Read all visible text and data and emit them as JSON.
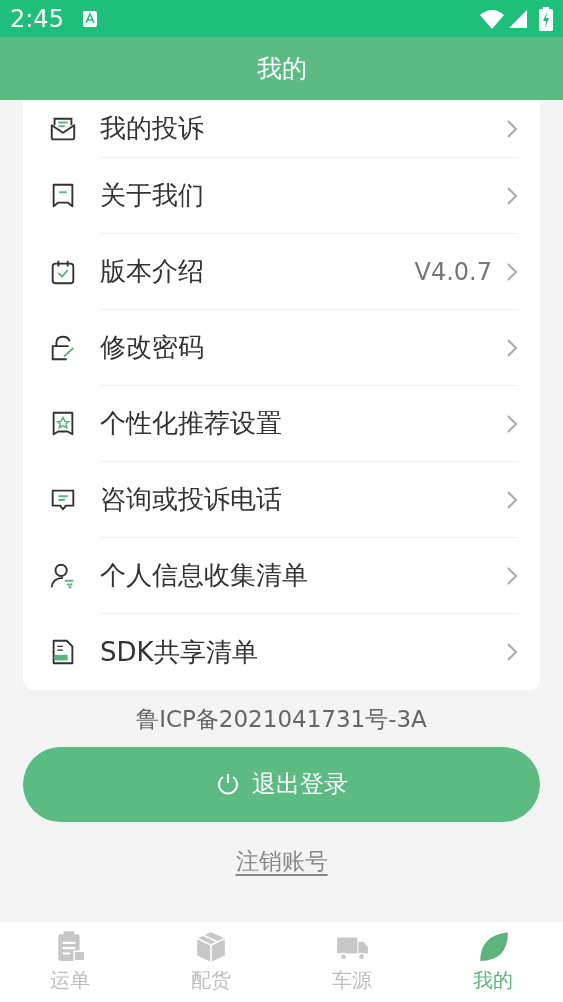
{
  "status_bar": {
    "time": "2:45"
  },
  "header": {
    "title": "我的"
  },
  "menu": [
    {
      "label": "我的投诉"
    },
    {
      "label": "关于我们"
    },
    {
      "label": "版本介绍",
      "value": "V4.0.7"
    },
    {
      "label": "修改密码"
    },
    {
      "label": "个性化推荐设置"
    },
    {
      "label": "咨询或投诉电话"
    },
    {
      "label": "个人信息收集清单"
    },
    {
      "label": "SDK共享清单"
    }
  ],
  "icp": "鲁ICP备2021041731号-3A",
  "logout_button": "退出登录",
  "cancel_link": "注销账号",
  "tabs": [
    {
      "label": "运单",
      "selected": false
    },
    {
      "label": "配货",
      "selected": false
    },
    {
      "label": "车源",
      "selected": false
    },
    {
      "label": "我的",
      "selected": true
    }
  ]
}
